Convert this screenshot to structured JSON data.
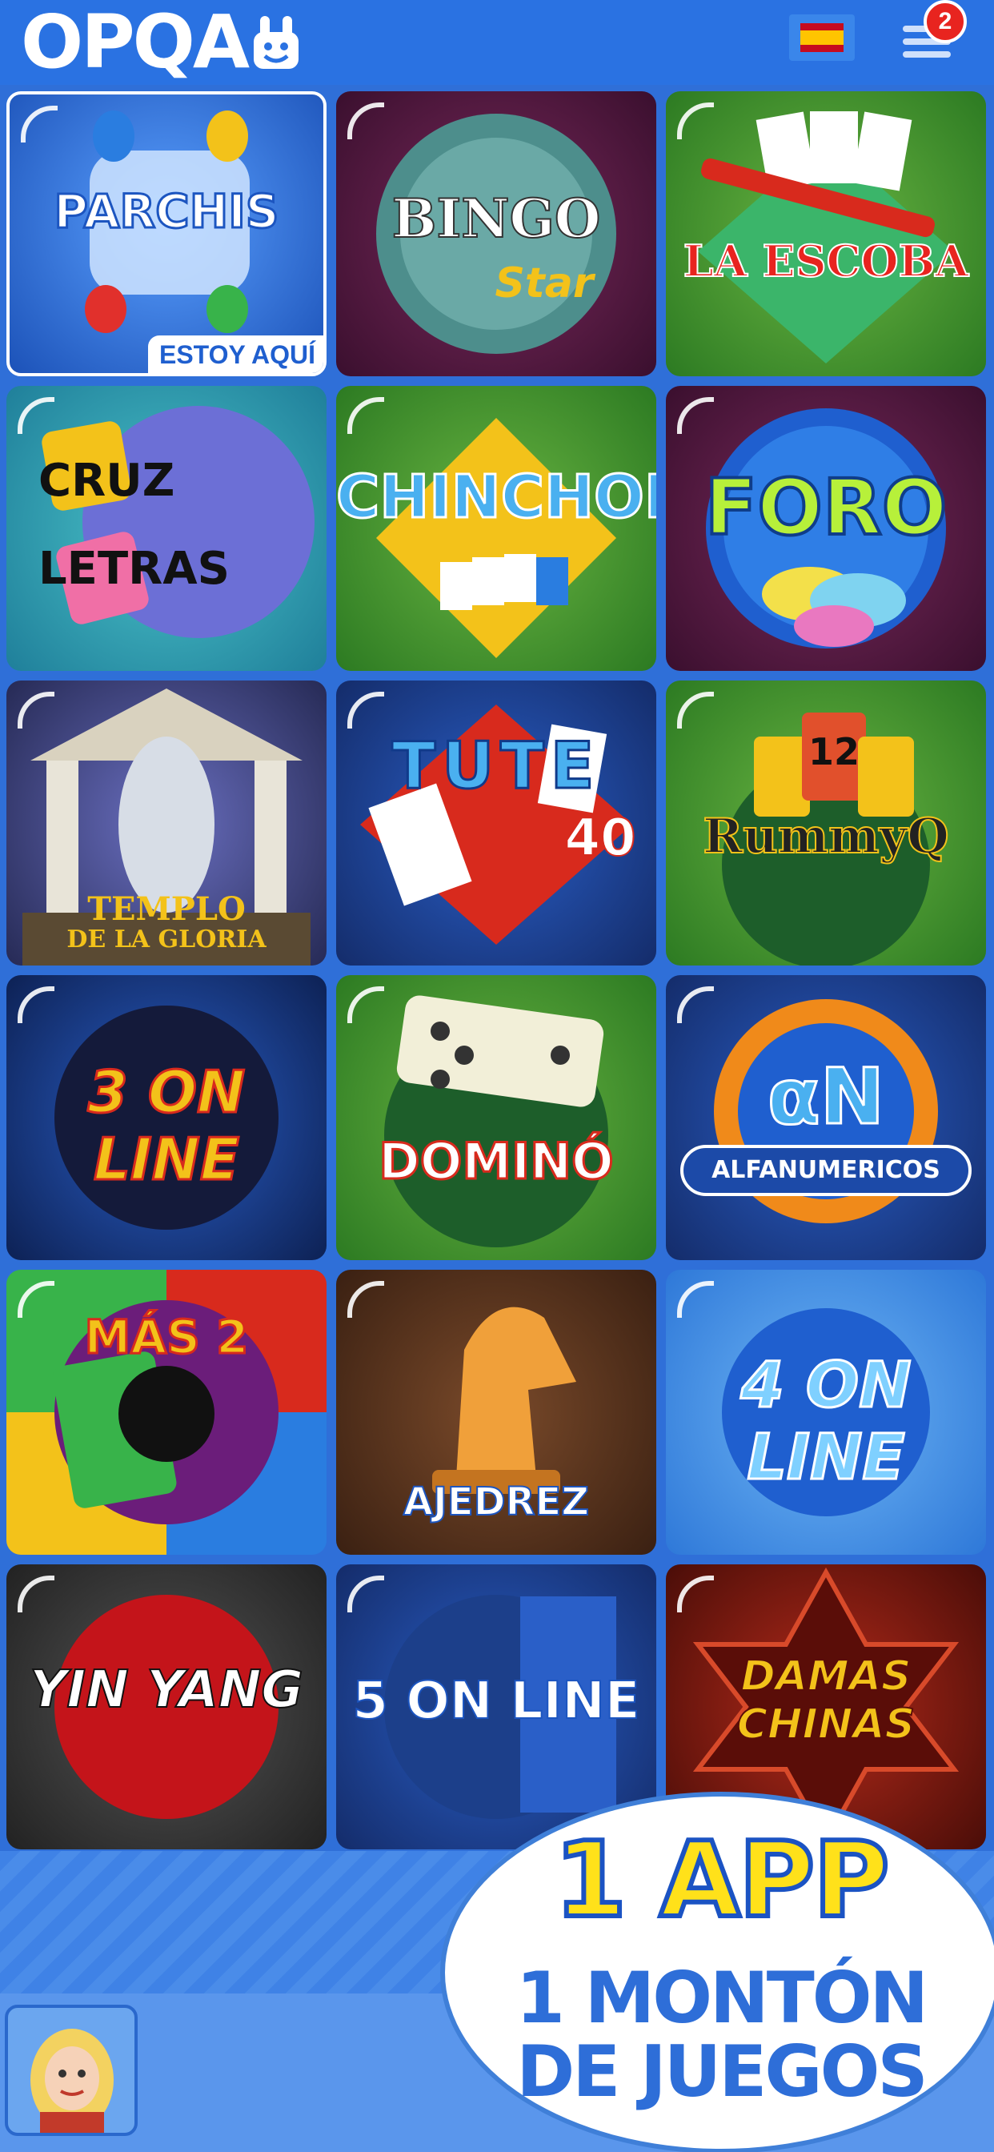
{
  "header": {
    "logo_text": "OPQA",
    "language_flag": "spain-flag-icon",
    "menu_icon": "hamburger-menu-icon",
    "notification_count": "2"
  },
  "games": [
    {
      "title": "PARCHIS",
      "badge": "ESTOY AQUÍ"
    },
    {
      "title": "BINGO",
      "subtitle": "Star"
    },
    {
      "title": "LA ESCOBA"
    },
    {
      "title": "CRUZ",
      "subtitle": "LETRAS"
    },
    {
      "title": "CHINCHON"
    },
    {
      "title": "FORO"
    },
    {
      "title": "TEMPLO",
      "subtitle": "DE LA GLORIA"
    },
    {
      "title": "TUTE",
      "subtitle": "40"
    },
    {
      "title": "RummyQ",
      "subtitle": "12"
    },
    {
      "title": "3 ON LINE"
    },
    {
      "title": "DOMINÓ"
    },
    {
      "title": "ALFANUMERICOS"
    },
    {
      "title": "MÁS 2"
    },
    {
      "title": "AJEDREZ"
    },
    {
      "title": "4 ON LINE"
    },
    {
      "title": "YIN YANG"
    },
    {
      "title": "5 ON LINE"
    },
    {
      "title": "DAMAS CHINAS"
    }
  ],
  "promo": {
    "line1": "1 APP",
    "line2": "1 MONTÓN",
    "line3": "DE JUEGOS"
  },
  "colors": {
    "header_blue": "#2a72e2",
    "badge_red": "#e8241f",
    "promo_yellow": "#ffe11a"
  }
}
